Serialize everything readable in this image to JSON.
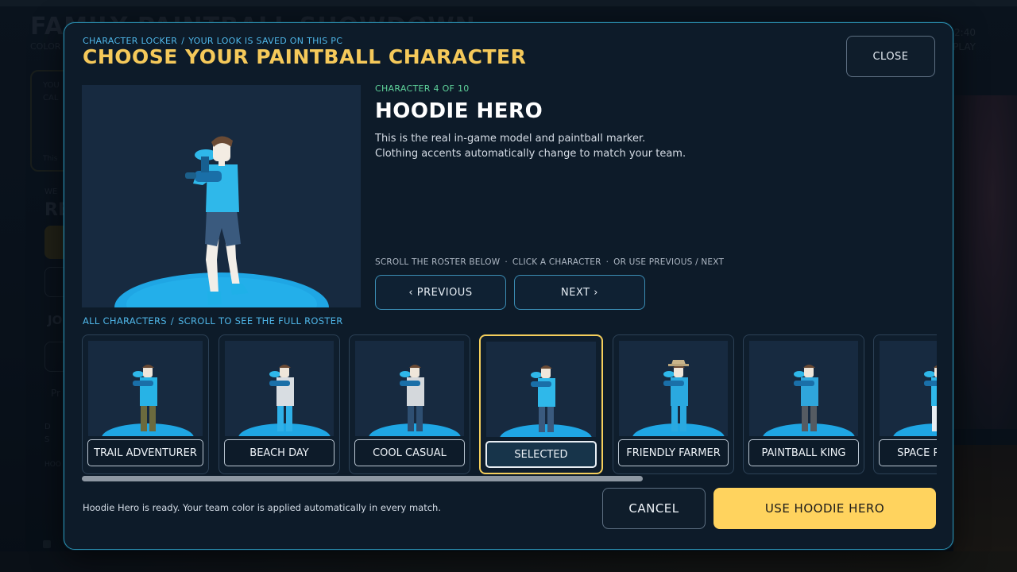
{
  "background": {
    "title": "FAMILY PAINTBALL SHOWDOWN",
    "subtitle": "COLOR",
    "right_line1": "2:40",
    "right_line2": "PLAY",
    "card_line1": "YOU",
    "card_line2": "CAL",
    "card_line3": "This",
    "section_label": "WE",
    "section_big": "RE",
    "section2": "JO",
    "field_label": "Pr",
    "side_line1": "D",
    "side_line2": "S",
    "footer_label": "HOO"
  },
  "modal": {
    "breadcrumb": [
      "CHARACTER LOCKER",
      "YOUR LOOK IS SAVED ON THIS PC"
    ],
    "breadcrumb_sep": "/",
    "title": "CHOOSE YOUR PAINTBALL CHARACTER",
    "close_label": "CLOSE"
  },
  "character": {
    "counter": "CHARACTER 4 OF 10",
    "name": "HOODIE HERO",
    "description_line1": "This is the real in-game model and paintball marker.",
    "description_line2": "Clothing accents automatically change to match your team."
  },
  "navigation": {
    "hints": [
      "SCROLL THE ROSTER BELOW",
      "CLICK A CHARACTER",
      "OR USE PREVIOUS / NEXT"
    ],
    "hint_sep": "·",
    "previous_label": "‹  PREVIOUS",
    "next_label": "NEXT  ›"
  },
  "roster": {
    "label": [
      "ALL CHARACTERS",
      "SCROLL TO SEE THE FULL ROSTER"
    ],
    "label_sep": "/",
    "cards": [
      {
        "label": "TRAIL ADVENTURER",
        "selected": false,
        "shirt": "#27b3e6",
        "pants": "#6b6a3e",
        "hat": false
      },
      {
        "label": "BEACH DAY",
        "selected": false,
        "shirt": "#d8dde2",
        "pants": "#2fb0e8",
        "hat": false
      },
      {
        "label": "COOL CASUAL",
        "selected": false,
        "shirt": "#d4d8dc",
        "pants": "#2e4f72",
        "hat": false
      },
      {
        "label": "SELECTED",
        "selected": true,
        "shirt": "#2fb8ea",
        "pants": "#3a5a7e",
        "hat": false
      },
      {
        "label": "FRIENDLY FARMER",
        "selected": false,
        "shirt": "#2aa9e0",
        "pants": "#2aa9e0",
        "hat": true
      },
      {
        "label": "PAINTBALL KING",
        "selected": false,
        "shirt": "#2fa6dc",
        "pants": "#555b62",
        "hat": false
      },
      {
        "label": "SPACE RANGER",
        "selected": false,
        "shirt": "#2fb8ea",
        "pants": "#e8edf2",
        "hat": false
      }
    ]
  },
  "footer": {
    "status": "Hoodie Hero is ready. Your team color is applied automatically in every match.",
    "cancel_label": "CANCEL",
    "confirm_label": "USE HOODIE HERO"
  },
  "colors": {
    "accent_yellow": "#f5c95a",
    "accent_blue": "#4fb6e8",
    "accent_green": "#5fd39b",
    "team_blue": "#27b3e6"
  }
}
